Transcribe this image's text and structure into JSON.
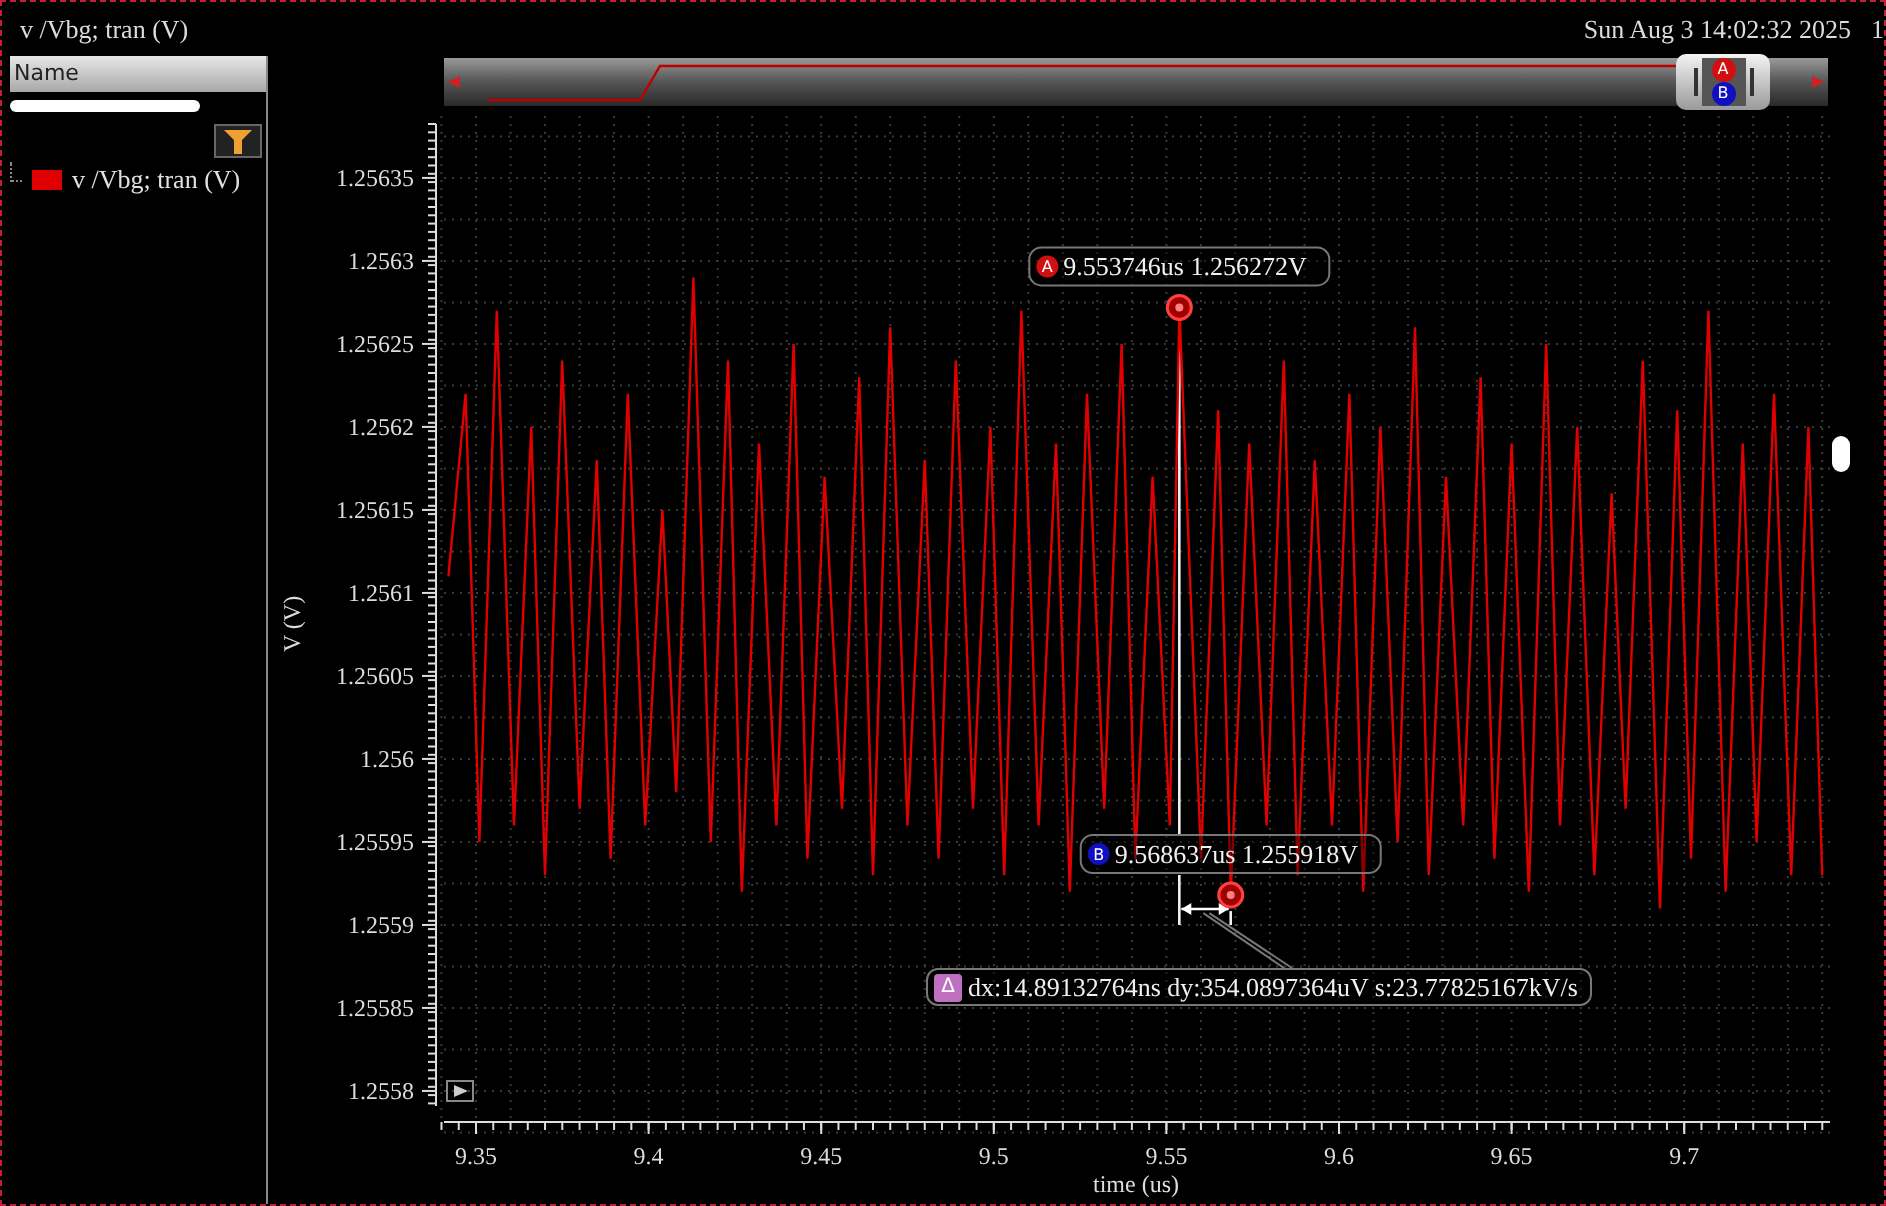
{
  "window": {
    "title": "v /Vbg; tran (V)",
    "timestamp": "Sun Aug 3 14:02:32 2025",
    "timestamp_cut": "1"
  },
  "legend": {
    "header": "Name"
  },
  "overview": {
    "handle_markers": [
      "A",
      "B"
    ]
  },
  "cursor_badges": [
    "A",
    "B"
  ],
  "delta": {
    "marker": "Δ",
    "text": "dx:14.89132764ns dy:354.0897364uV s:23.77825167kV/s"
  },
  "chart_data": {
    "type": "line",
    "xlabel": "time (us)",
    "ylabel": "V (V)",
    "grid": true,
    "xlim": [
      9.34073,
      9.74224
    ],
    "ylim": [
      1.2557825,
      1.2563873
    ],
    "xticks": [
      9.35,
      9.4,
      9.45,
      9.5,
      9.55,
      9.6,
      9.65,
      9.7
    ],
    "yticks": [
      1.2558,
      1.25585,
      1.2559,
      1.25595,
      1.256,
      1.25605,
      1.2561,
      1.25615,
      1.2562,
      1.25625,
      1.2563,
      1.25635
    ],
    "x": [
      9.342,
      9.347,
      9.351,
      9.356,
      9.361,
      9.366,
      9.37,
      9.375,
      9.38,
      9.385,
      9.389,
      9.394,
      9.399,
      9.404,
      9.408,
      9.413,
      9.418,
      9.423,
      9.427,
      9.432,
      9.437,
      9.442,
      9.446,
      9.451,
      9.456,
      9.461,
      9.465,
      9.47,
      9.475,
      9.48,
      9.484,
      9.489,
      9.494,
      9.499,
      9.503,
      9.508,
      9.513,
      9.518,
      9.522,
      9.527,
      9.532,
      9.537,
      9.541,
      9.546,
      9.551,
      9.553746,
      9.56,
      9.565,
      9.568637,
      9.574,
      9.579,
      9.584,
      9.588,
      9.593,
      9.598,
      9.603,
      9.607,
      9.612,
      9.617,
      9.622,
      9.626,
      9.631,
      9.636,
      9.641,
      9.645,
      9.65,
      9.655,
      9.66,
      9.664,
      9.669,
      9.674,
      9.679,
      9.683,
      9.688,
      9.693,
      9.698,
      9.702,
      9.707,
      9.712,
      9.717,
      9.721,
      9.726,
      9.731,
      9.736,
      9.74
    ],
    "series": [
      {
        "name": "v /Vbg; tran (V)",
        "color": "#e00000",
        "values": [
          1.25611,
          1.25622,
          1.25595,
          1.25627,
          1.25596,
          1.2562,
          1.25593,
          1.25624,
          1.25597,
          1.25618,
          1.25594,
          1.25622,
          1.25596,
          1.25615,
          1.25598,
          1.25629,
          1.25595,
          1.25624,
          1.25592,
          1.25619,
          1.25596,
          1.25625,
          1.25594,
          1.25617,
          1.25597,
          1.25623,
          1.25593,
          1.25626,
          1.25596,
          1.25618,
          1.25594,
          1.25624,
          1.25597,
          1.2562,
          1.25593,
          1.25627,
          1.25596,
          1.25619,
          1.25592,
          1.25622,
          1.25597,
          1.25625,
          1.25594,
          1.25617,
          1.25596,
          1.256272,
          1.25594,
          1.25621,
          1.255918,
          1.25619,
          1.25596,
          1.25624,
          1.25593,
          1.25618,
          1.25596,
          1.25622,
          1.25592,
          1.2562,
          1.25595,
          1.25626,
          1.25593,
          1.25617,
          1.25596,
          1.25623,
          1.25594,
          1.25619,
          1.25592,
          1.25625,
          1.25596,
          1.2562,
          1.25593,
          1.25616,
          1.25597,
          1.25624,
          1.25591,
          1.25621,
          1.25594,
          1.25627,
          1.25592,
          1.25619,
          1.25595,
          1.25622,
          1.25593,
          1.2562,
          1.25593
        ]
      }
    ],
    "ref_lines": [
      {
        "axis": "x",
        "value": 9.553746
      },
      {
        "axis": "x",
        "value": 9.568637
      }
    ],
    "annotations": [
      {
        "x": 9.553746,
        "y": 1.256272,
        "text": "9.553746us 1.256272V"
      },
      {
        "x": 9.568637,
        "y": 1.255918,
        "text": "9.568637us 1.255918V"
      }
    ]
  }
}
